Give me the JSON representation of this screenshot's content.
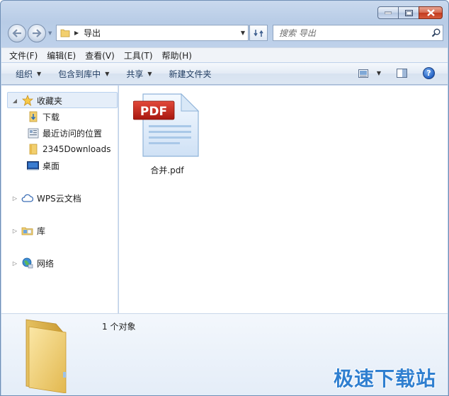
{
  "window": {
    "caption_buttons": [
      "minimize",
      "maximize",
      "close"
    ]
  },
  "address": {
    "path_segment": "导出",
    "search_placeholder": "搜索 导出"
  },
  "menu": {
    "items": [
      "文件(F)",
      "编辑(E)",
      "查看(V)",
      "工具(T)",
      "帮助(H)"
    ]
  },
  "toolbar": {
    "organize": "组织",
    "include_in_library": "包含到库中",
    "share": "共享",
    "new_folder": "新建文件夹"
  },
  "navpane": {
    "favorites": "收藏夹",
    "downloads": "下载",
    "recent": "最近访问的位置",
    "downloads2345": "2345Downloads",
    "desktop": "桌面",
    "wps": "WPS云文档",
    "libraries": "库",
    "network": "网络"
  },
  "content": {
    "files": [
      {
        "name": "合并.pdf",
        "badge": "PDF"
      }
    ]
  },
  "details": {
    "count": "1 个对象"
  },
  "watermark": "极速下载站",
  "colors": {
    "pdf_red": "#c8251d",
    "folder_yellow": "#f2d27a",
    "accent_blue": "#2f7fd0"
  }
}
